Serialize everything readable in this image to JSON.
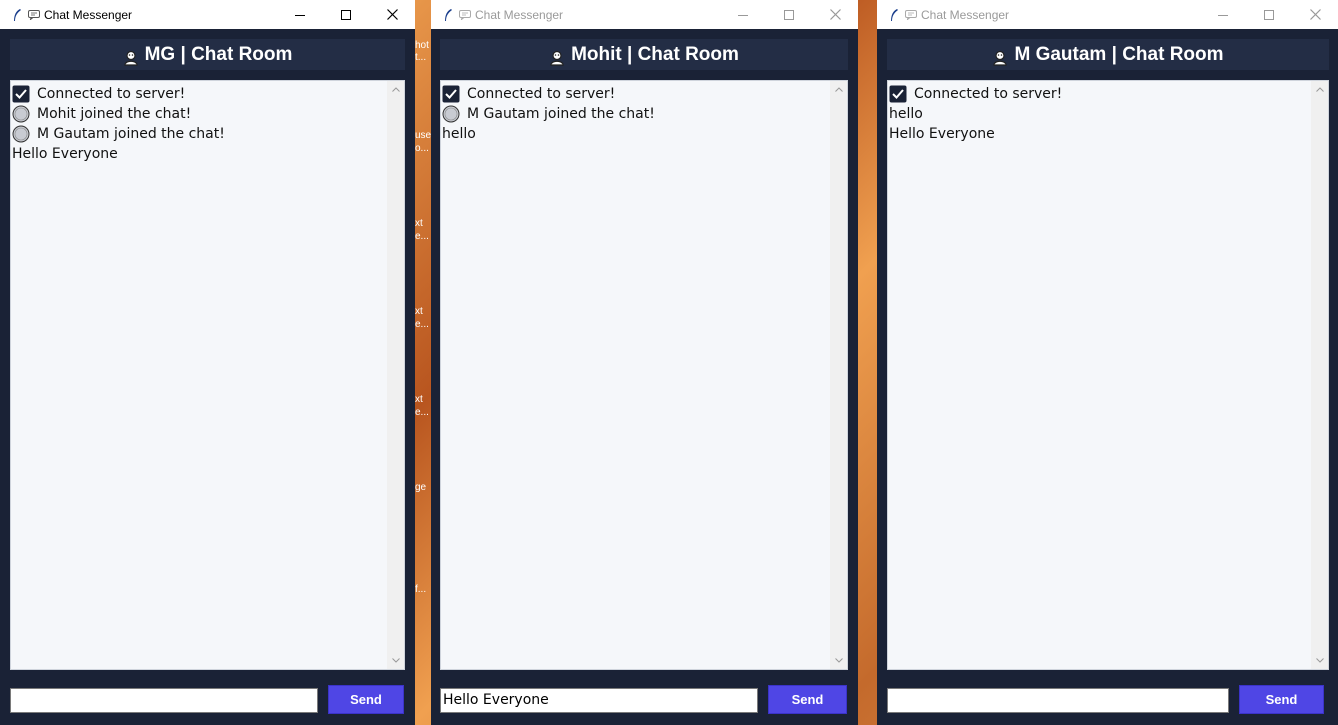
{
  "windows": [
    {
      "title": "Chat Messenger",
      "header": "MG | Chat Room",
      "messages": [
        {
          "icon": "check",
          "text": "Connected to server!"
        },
        {
          "icon": "circle",
          "text": "Mohit joined the chat!"
        },
        {
          "icon": "circle",
          "text": "M Gautam joined the chat!"
        },
        {
          "icon": "none",
          "text": "Hello Everyone"
        }
      ],
      "input_value": "",
      "send_label": "Send"
    },
    {
      "title": "Chat Messenger",
      "header": "Mohit | Chat Room",
      "messages": [
        {
          "icon": "check",
          "text": "Connected to server!"
        },
        {
          "icon": "circle",
          "text": "M Gautam joined the chat!"
        },
        {
          "icon": "none",
          "text": "hello"
        }
      ],
      "input_value": "Hello Everyone",
      "send_label": "Send"
    },
    {
      "title": "Chat Messenger",
      "header": "M Gautam | Chat Room",
      "messages": [
        {
          "icon": "check",
          "text": "Connected to server!"
        },
        {
          "icon": "none",
          "text": "hello"
        },
        {
          "icon": "none",
          "text": "Hello Everyone"
        }
      ],
      "input_value": "",
      "send_label": "Send"
    }
  ],
  "desktop_fragments": [
    "hot",
    "t...",
    "use",
    "o...",
    "xt",
    "e...",
    "xt",
    "e...",
    "xt",
    "e...",
    "ge",
    "f..."
  ],
  "colors": {
    "window_bg": "#1a2236",
    "header_bg": "#232d45",
    "send_bg": "#4f46e5",
    "chat_bg": "#f5f7fa"
  }
}
